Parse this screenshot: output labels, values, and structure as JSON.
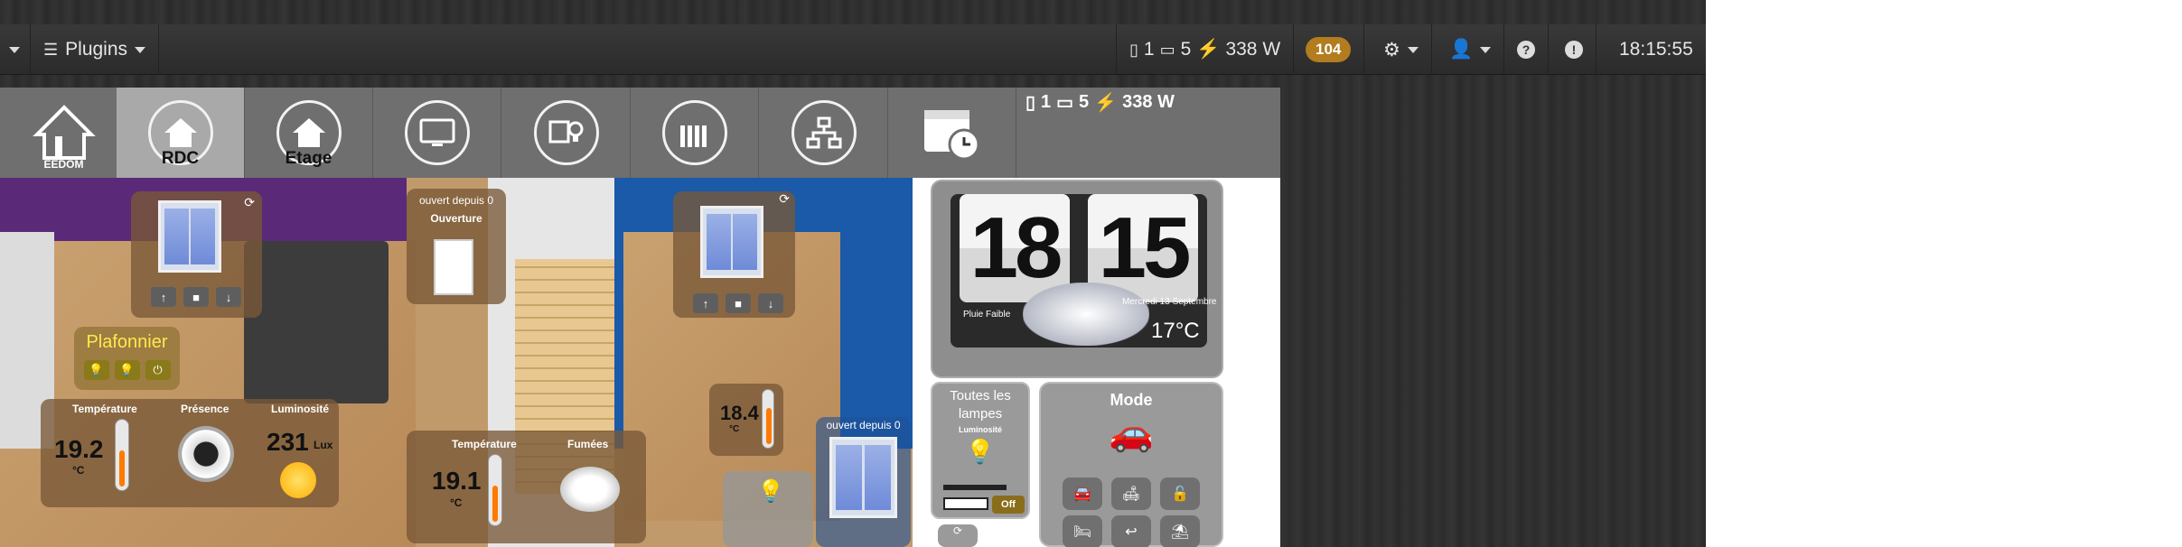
{
  "navbar": {
    "plugins_label": "Plugins",
    "stat_opened": "1",
    "stat_closed": "5",
    "stat_power": "338 W",
    "messages_count": "104",
    "time": "18:15:55"
  },
  "menu": {
    "items": [
      {
        "label": "",
        "icon": "jeedom-home-logo"
      },
      {
        "label": "RDC",
        "icon": "house-icon"
      },
      {
        "label": "Etage",
        "icon": "house-icon"
      },
      {
        "label": "",
        "icon": "tv-icon"
      },
      {
        "label": "",
        "icon": "lamp-panel-icon"
      },
      {
        "label": "",
        "icon": "radiator-icon"
      },
      {
        "label": "",
        "icon": "network-icon"
      },
      {
        "label": "",
        "icon": "calendar-clock-icon"
      }
    ],
    "logo_text": "EEDOM",
    "stat_opened": "1",
    "stat_closed": "5",
    "stat_power": "338 W"
  },
  "plan": {
    "plafonnier_label": "Plafonnier",
    "temperature_label": "Température",
    "presence_label": "Présence",
    "luminosite_label": "Luminosité",
    "temp_salon": "19.2",
    "temp_unit": "°C",
    "lux_value": "231",
    "lux_unit": "Lux",
    "ouvert_depuis_1": "ouvert depuis 0",
    "ouverture_label": "Ouverture",
    "temperature_label_2": "Température",
    "fumees_label": "Fumées",
    "temp_entree": "19.1",
    "temp_chambre": "18.4",
    "ouvert_depuis_2": "ouvert depuis 0"
  },
  "clock": {
    "hour": "18",
    "minute": "15",
    "weather": "Pluie Faible",
    "date": "Mercredi 13 Septembre",
    "outside_temp": "17°C"
  },
  "lamps": {
    "title": "Toutes les lampes",
    "sublabel": "Luminosité",
    "toggle": "Off"
  },
  "mode": {
    "title": "Mode"
  },
  "colors": {
    "badge": "#b27c1f",
    "purple_wall": "#5a2a78",
    "menu_active": "#a9a9a9"
  }
}
